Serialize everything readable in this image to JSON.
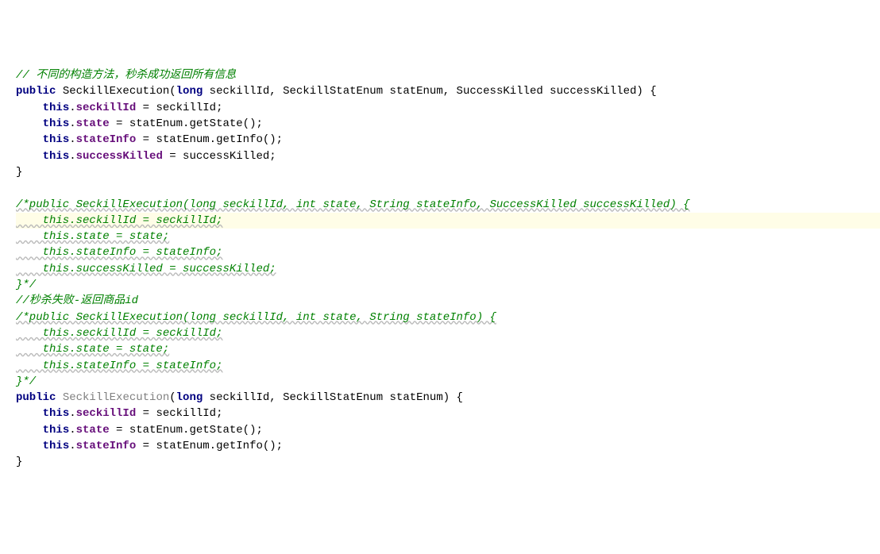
{
  "code": {
    "l1_comment": "// 不同的构造方法，秒杀成功返回所有信息",
    "l2_kw1": "public",
    "l2_ctor": " SeckillExecution(",
    "l2_kw2": "long",
    "l2_p1": " seckillId, ",
    "l2_t2": "SeckillStatEnum",
    "l2_p2": " statEnum, ",
    "l2_t3": "SuccessKilled",
    "l2_p3": " successKilled) {",
    "l3_this": "this",
    "l3_dot": ".",
    "l3_field": "seckillId",
    "l3_rest": " = seckillId;",
    "l4_this": "this",
    "l4_dot": ".",
    "l4_field": "state",
    "l4_rest": " = statEnum.getState();",
    "l5_this": "this",
    "l5_dot": ".",
    "l5_field": "stateInfo",
    "l5_rest": " = statEnum.getInfo();",
    "l6_this": "this",
    "l6_dot": ".",
    "l6_field": "successKilled",
    "l6_rest": " = successKilled;",
    "l7": "}",
    "l8": "",
    "l9": "/*public SeckillExecution(long seckillId, int state, String stateInfo, SuccessKilled successKilled) {",
    "l10": "    this.seckillId = seckillId;",
    "l11": "    this.state = state;",
    "l12": "    this.stateInfo = stateInfo;",
    "l13": "    this.successKilled = successKilled;",
    "l14": "}*/",
    "l15": "//秒杀失败-返回商品id",
    "l16": "/*public SeckillExecution(long seckillId, int state, String stateInfo) {",
    "l17": "    this.seckillId = seckillId;",
    "l18": "    this.state = state;",
    "l19": "    this.stateInfo = stateInfo;",
    "l20": "}*/",
    "l21_kw1": "public",
    "l21_ctor": "SeckillExecution",
    "l21_paren": "(",
    "l21_kw2": "long",
    "l21_p1": " seckillId, ",
    "l21_t2": "SeckillStatEnum",
    "l21_p2": " statEnum) {",
    "l22_this": "this",
    "l22_dot": ".",
    "l22_field": "seckillId",
    "l22_rest": " = seckillId;",
    "l23_this": "this",
    "l23_dot": ".",
    "l23_field": "state",
    "l23_rest": " = statEnum.getState();",
    "l24_this": "this",
    "l24_dot": ".",
    "l24_field": "stateInfo",
    "l24_rest": " = statEnum.getInfo();",
    "l25": "}"
  }
}
